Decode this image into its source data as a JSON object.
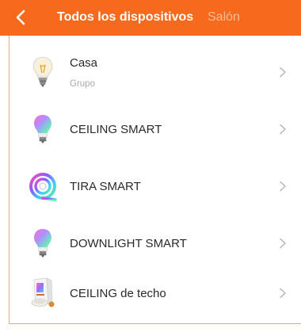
{
  "header": {
    "background": "#f56a1c",
    "back_icon": "chevron-left-icon",
    "tabs": [
      {
        "label": "Todos los dispositivos",
        "active": true
      },
      {
        "label": "Salón",
        "active": false
      }
    ]
  },
  "devices": [
    {
      "name": "Casa",
      "subtitle": "Grupo",
      "icon": "warm-bulb-icon"
    },
    {
      "name": "CEILING SMART",
      "icon": "rgb-bulb-icon"
    },
    {
      "name": "TIRA SMART",
      "icon": "led-strip-icon"
    },
    {
      "name": "DOWNLIGHT SMART",
      "icon": "rgb-bulb-icon"
    },
    {
      "name": "CEILING de techo",
      "icon": "product-box-icon"
    }
  ],
  "colors": {
    "accent": "#f56a1c",
    "list_border": "#f0a47c",
    "chevron": "#b5b5b5"
  }
}
